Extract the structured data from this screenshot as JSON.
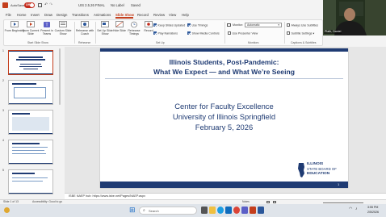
{
  "title_bar": {
    "autosave_label": "AutoSave",
    "autosave_state": "Off",
    "filename": "UIS 2.5.26 FINAL",
    "label_status": "No Label",
    "save_status": "Saved"
  },
  "tabs": [
    "File",
    "Home",
    "Insert",
    "Draw",
    "Design",
    "Transitions",
    "Animations",
    "Slide Show",
    "Record",
    "Review",
    "View",
    "Help"
  ],
  "active_tab": "Slide Show",
  "record_button": "Record",
  "ribbon": {
    "start_group": {
      "label": "Start Slide Show",
      "buttons": [
        "From Beginning",
        "From Current Slide",
        "Present in Teams",
        "Custom Slide Show"
      ]
    },
    "rehearse_group": {
      "label": "Rehearse",
      "buttons": [
        "Rehearse with Coach"
      ]
    },
    "setup_group": {
      "label": "Set Up",
      "buttons": [
        "Set Up Slide Show",
        "Hide Slide",
        "Rehearse Timings",
        "Record"
      ],
      "checks": [
        {
          "label": "Keep Slides Updated",
          "checked": true
        },
        {
          "label": "Play Narrations",
          "checked": true
        },
        {
          "label": "Use Timings",
          "checked": true
        },
        {
          "label": "Show Media Controls",
          "checked": true
        }
      ]
    },
    "monitors_group": {
      "label": "Monitors",
      "monitor_label": "Monitor:",
      "monitor_value": "Automatic",
      "presenter_view": {
        "label": "Use Presenter View",
        "checked": false
      }
    },
    "captions_group": {
      "label": "Captions & Subtitles",
      "always_subtitles": {
        "label": "Always Use Subtitles",
        "checked": false
      },
      "subtitle_settings": "Subtitle Settings"
    }
  },
  "video": {
    "participant": "Plath, Daniel"
  },
  "thumbnails": [
    {
      "number": "1",
      "selected": true
    },
    {
      "number": "2",
      "selected": false
    },
    {
      "number": "3",
      "selected": false
    },
    {
      "number": "4",
      "selected": false
    },
    {
      "number": "5",
      "selected": false
    }
  ],
  "slide": {
    "title_line1": "Illinois Students, Post-Pandemic:",
    "title_line2": "What We Expect — and What We’re Seeing",
    "body_line1": "Center for Faculty Excellence",
    "body_line2": "University of Illinois Springfield",
    "body_line3": "February 5, 2026",
    "logo_line1": "ILLINOIS",
    "logo_line2": "STATE BOARD OF",
    "logo_line3": "EDUCATION",
    "page_number": "1"
  },
  "notes_text": "ISBE NAEP hub: https://www.isbe.net/Pages/NAEP.aspx",
  "status": {
    "slide_counter": "Slide 1 of 13",
    "accessibility": "Accessibility: Good to go",
    "notes_label": "Notes"
  },
  "taskbar": {
    "search_placeholder": "Search",
    "time": "3:55 PM",
    "date": "2/5/2026"
  },
  "colors": {
    "accent": "#c43e1c",
    "slide_navy": "#1f3b73"
  },
  "icons": [
    "windows-start-icon",
    "search-icon",
    "task-view-icon",
    "file-explorer-icon",
    "edge-icon",
    "outlook-icon",
    "teams-icon",
    "powerpoint-icon",
    "chrome-icon",
    "wifi-icon",
    "volume-icon"
  ]
}
